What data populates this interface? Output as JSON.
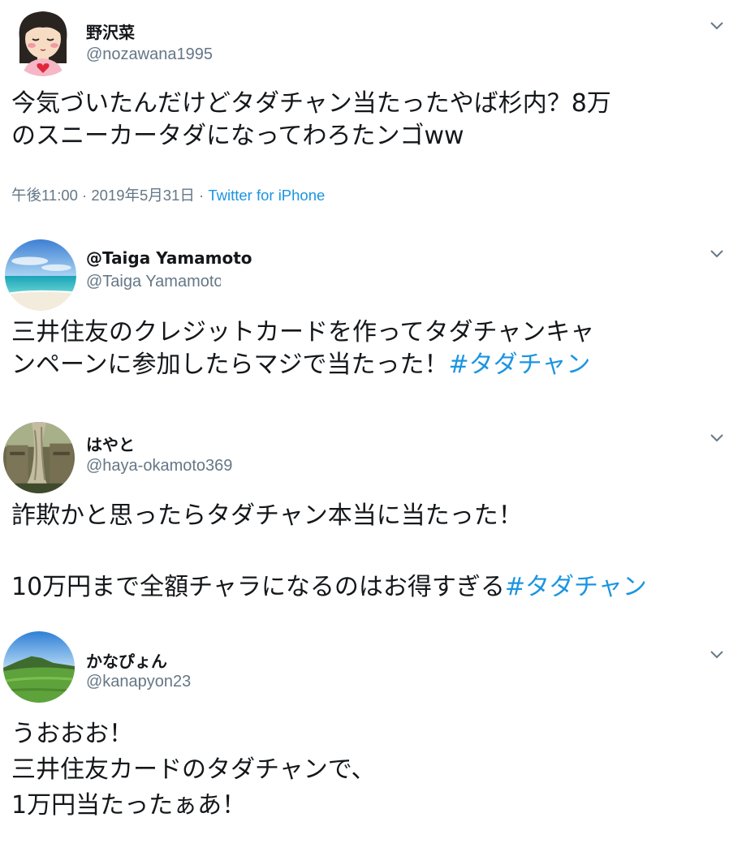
{
  "tweets": [
    {
      "name": "野沢菜",
      "handle": "@nozawana1995",
      "avatar": "cartoon-girl-avatar",
      "lines": [
        "今気づいたんだけどタダチャン当たったやば杉内？8万",
        "のスニーカータダになってわろたンゴww"
      ],
      "time": "午後11:00 · 2019年5月31日",
      "sep": " · ",
      "via": "Twitter for iPhone"
    },
    {
      "name": "@Taiga Yamamoto",
      "handle": "@Taiga Yamamoto",
      "avatar": "beach-photo-avatar",
      "lines": [
        "三井住友のクレジットカードを作ってタダチャンキャ",
        "ンペーンに参加したらマジで当たった！"
      ],
      "hashtag": "#タダチャン"
    },
    {
      "name": "はやと",
      "handle": "@haya-okamoto369",
      "avatar": "ruins-photo-avatar",
      "lines": [
        "詐欺かと思ったらタダチャン本当に当たった！",
        "",
        "10万円まで全額チャラになるのはお得すぎる"
      ],
      "hashtag": "#タダチャン"
    },
    {
      "name": "かなぴょん",
      "handle": "@kanapyon23",
      "avatar": "mountain-photo-avatar",
      "lines": [
        "うおおお！",
        "三井住友カードのタダチャンで、",
        "1万円当たったぁあ！"
      ]
    }
  ],
  "colors": {
    "text": "#14171a",
    "secondary": "#657786",
    "link": "#1b95e0",
    "background": "#ffffff"
  },
  "icons": {
    "menu": "chevron-down-icon"
  }
}
